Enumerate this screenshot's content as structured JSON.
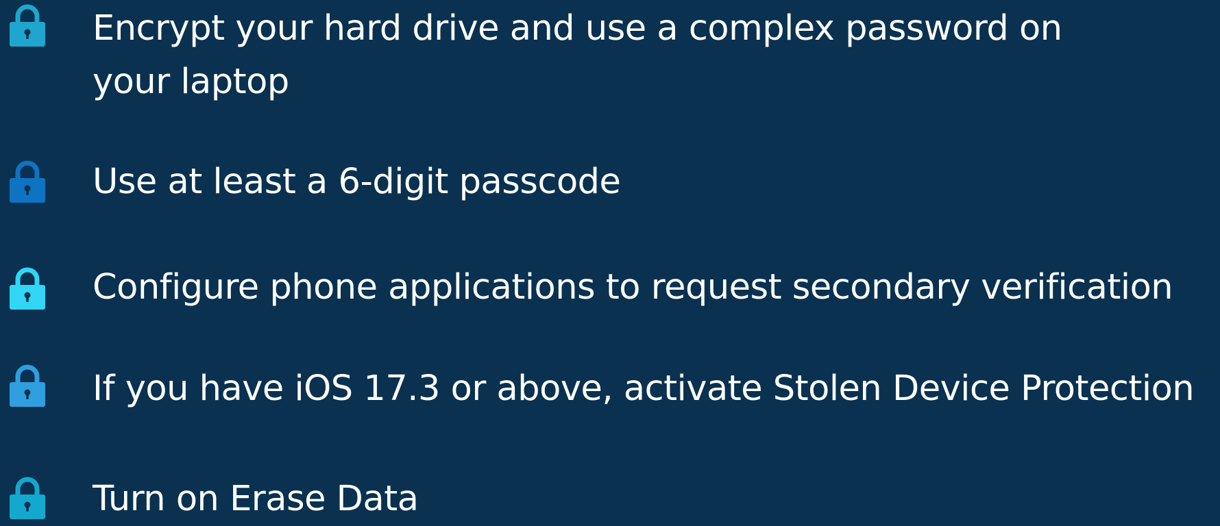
{
  "bullets": [
    {
      "icon": "lock-icon",
      "color": "#1fa6cf",
      "text": "Encrypt your hard drive and use a complex password on your laptop"
    },
    {
      "icon": "lock-icon",
      "color": "#0d73c2",
      "text": "Use at least a 6-digit passcode"
    },
    {
      "icon": "lock-icon",
      "color": "#32d6f5",
      "text": "Configure phone applications to request secondary verification"
    },
    {
      "icon": "lock-icon",
      "color": "#2f9fe0",
      "text": "If you have iOS 17.3 or above, activate Stolen Device Protection"
    },
    {
      "icon": "lock-icon",
      "color": "#13a9cf",
      "text": "Turn on Erase Data"
    }
  ],
  "colors": {
    "background": "#0a3150",
    "text": "#ffffff"
  }
}
